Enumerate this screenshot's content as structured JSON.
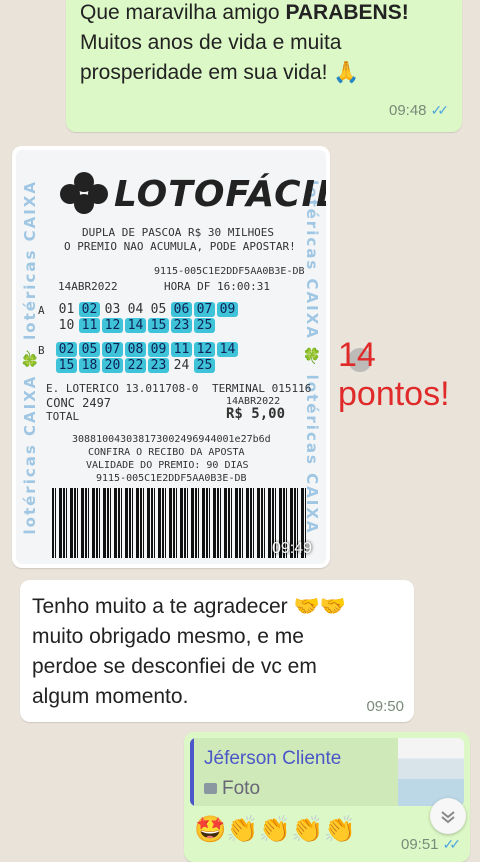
{
  "messages": {
    "m1": {
      "line1_a": "Que maravilha amigo ",
      "line1_b": "PARABENS!",
      "line2": "Muitos anos de vida e muita",
      "line3": "prosperidade em sua vida! ",
      "emoji": "🙏",
      "time": "09:48",
      "ticks": "✓✓"
    },
    "photo": {
      "time": "09:49"
    },
    "m2": {
      "line1": "Tenho muito a te agradecer ",
      "emoji": "🤝🤝",
      "line2": "muito obrigado mesmo, e me",
      "line3": "perdoe se desconfiei de vc em",
      "line4": "algum momento.",
      "time": "09:50"
    },
    "m3": {
      "quote_author": "Jéferson Cliente",
      "quote_label": "Foto",
      "emojis": "🤩👏👏👏👏",
      "time": "09:51",
      "ticks": "✓✓"
    }
  },
  "overlay": {
    "points_text": "14 pontos!",
    "points_color": "#e02a2a"
  },
  "ticket": {
    "side_text_left": "lotéricas CAIXA 🍀 lotéricas CAIXA",
    "side_text_right": "lotéricas CAIXA 🍀 lotéricas CAIXA",
    "logo": "LOTOFÁCIL",
    "line1": "DUPLA DE PASCOA R$ 30 MILHOES",
    "line2": "O PREMIO NAO ACUMULA, PODE APOSTAR!",
    "code_top": "9115-005C1E2DDF5AA0B3E-DB",
    "date": "14ABR2022",
    "hour": "HORA DF 16:00:31",
    "game_a_label": "A",
    "game_a_row1": [
      "01",
      "02",
      "03",
      "04",
      "05",
      "06",
      "07",
      "09"
    ],
    "game_a_row2": [
      "10",
      "11",
      "12",
      "14",
      "15",
      "23",
      "25"
    ],
    "game_b_label": "B",
    "game_b_row1": [
      "02",
      "05",
      "07",
      "08",
      "09",
      "11",
      "12",
      "14"
    ],
    "game_b_row2": [
      "15",
      "18",
      "20",
      "22",
      "23",
      "24",
      "25"
    ],
    "loterico": "E. LOTERICO 13.011708-0",
    "terminal": "TERMINAL  015116",
    "conc": "CONC  2497",
    "date2": "14ABR2022",
    "total_label": "TOTAL",
    "total_value": "R$ 5,00",
    "hash": "308810043038173002496944001e27b6d",
    "confira": "CONFIRA O RECIBO DA APOSTA",
    "validade": "VALIDADE DO PREMIO: 90 DIAS",
    "code_bottom": "9115-005C1E2DDF5AA0B3E-DB"
  },
  "icons": {
    "scroll_down": "chevron-down-icon",
    "photo_icon": "image-icon"
  },
  "colors": {
    "outgoing": "#dcf8c6",
    "incoming": "#ffffff",
    "background": "#e9e3da",
    "read_ticks": "#4fa6e0",
    "quote_bar": "#4b56c9"
  }
}
